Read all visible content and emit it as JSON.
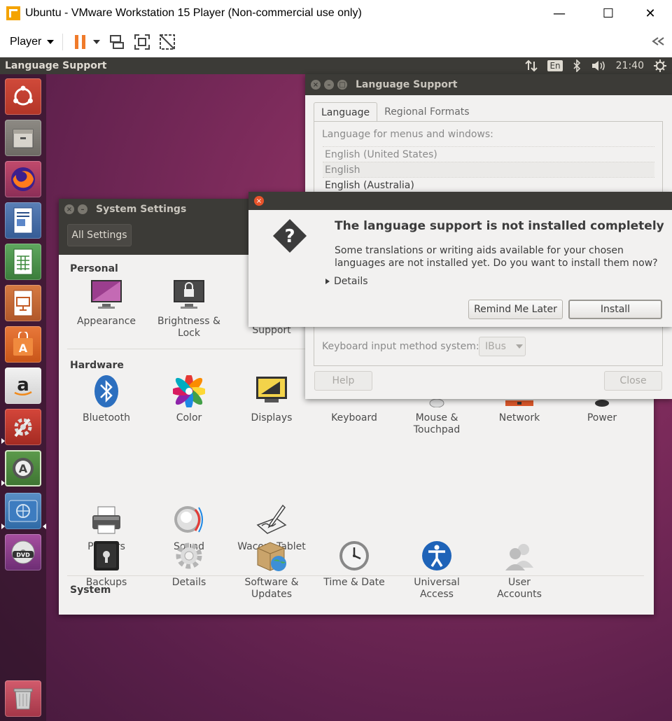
{
  "vm": {
    "title": "Ubuntu - VMware Workstation 15 Player (Non-commercial use only)",
    "menu_label": "Player",
    "window_controls": {
      "minimize": "—",
      "maximize": "☐",
      "close": "✕"
    }
  },
  "ubuntu": {
    "topbar_title": "Language Support",
    "keyboard_layout": "En",
    "clock": "21:40",
    "launcher_icons": [
      "ubuntu-dash-icon",
      "files-icon",
      "firefox-icon",
      "libreoffice-writer-icon",
      "libreoffice-calc-icon",
      "libreoffice-impress-icon",
      "ubuntu-software-icon",
      "amazon-icon",
      "system-settings-icon",
      "software-updater-icon",
      "language-support-icon",
      "dvd-icon",
      "trash-icon"
    ]
  },
  "settings": {
    "title": "System Settings",
    "all_settings": "All Settings",
    "sections": {
      "personal": "Personal",
      "hardware": "Hardware",
      "system": "System"
    },
    "personal_items": [
      "Appearance",
      "Brightness &\nLock",
      "Support"
    ],
    "hardware_items_row1": [
      "Bluetooth",
      "Color",
      "Displays",
      "Keyboard",
      "Mouse &\nTouchpad",
      "Network",
      "Power"
    ],
    "hardware_items_row2": [
      "Printers",
      "Sound",
      "Wacom Tablet"
    ],
    "system_items": [
      "Backups",
      "Details",
      "Software &\nUpdates",
      "Time & Date",
      "Universal\nAccess",
      "User\nAccounts"
    ]
  },
  "language_support": {
    "title": "Language Support",
    "tabs": [
      "Language",
      "Regional Formats"
    ],
    "list_label": "Language for menus and windows:",
    "languages": [
      "English (United States)",
      "English",
      "English (Australia)"
    ],
    "im_label": "Keyboard input method system:",
    "im_value": "IBus",
    "help": "Help",
    "close": "Close"
  },
  "dialog": {
    "heading": "The language support is not installed completely",
    "body": "Some translations or writing aids available for your chosen languages are not installed yet. Do you want to install them now?",
    "details": "Details",
    "remind": "Remind Me Later",
    "install": "Install"
  }
}
